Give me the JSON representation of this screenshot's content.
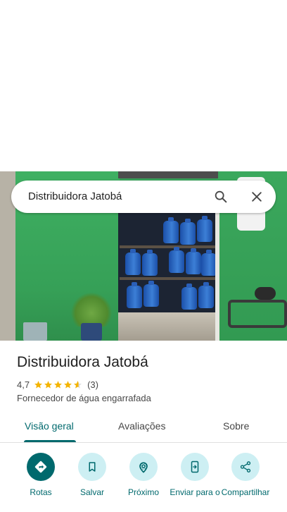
{
  "search": {
    "query": "Distribuidora Jatobá"
  },
  "place": {
    "name": "Distribuidora Jatobá",
    "rating": "4,7",
    "rating_value": 4.7,
    "review_count": "(3)",
    "category": "Fornecedor de água engarrafada"
  },
  "tabs": [
    {
      "label": "Visão geral",
      "active": true
    },
    {
      "label": "Avaliações",
      "active": false
    },
    {
      "label": "Sobre",
      "active": false
    }
  ],
  "actions": [
    {
      "label": "Rotas",
      "icon": "directions-icon"
    },
    {
      "label": "Salvar",
      "icon": "bookmark-icon"
    },
    {
      "label": "Próximo",
      "icon": "nearby-icon"
    },
    {
      "label": "Enviar para o",
      "icon": "send-to-phone-icon"
    },
    {
      "label": "Compartilhar",
      "icon": "share-icon"
    }
  ],
  "colors": {
    "accent": "#00696d",
    "chip": "#cdeff3",
    "star": "#f4b400"
  }
}
